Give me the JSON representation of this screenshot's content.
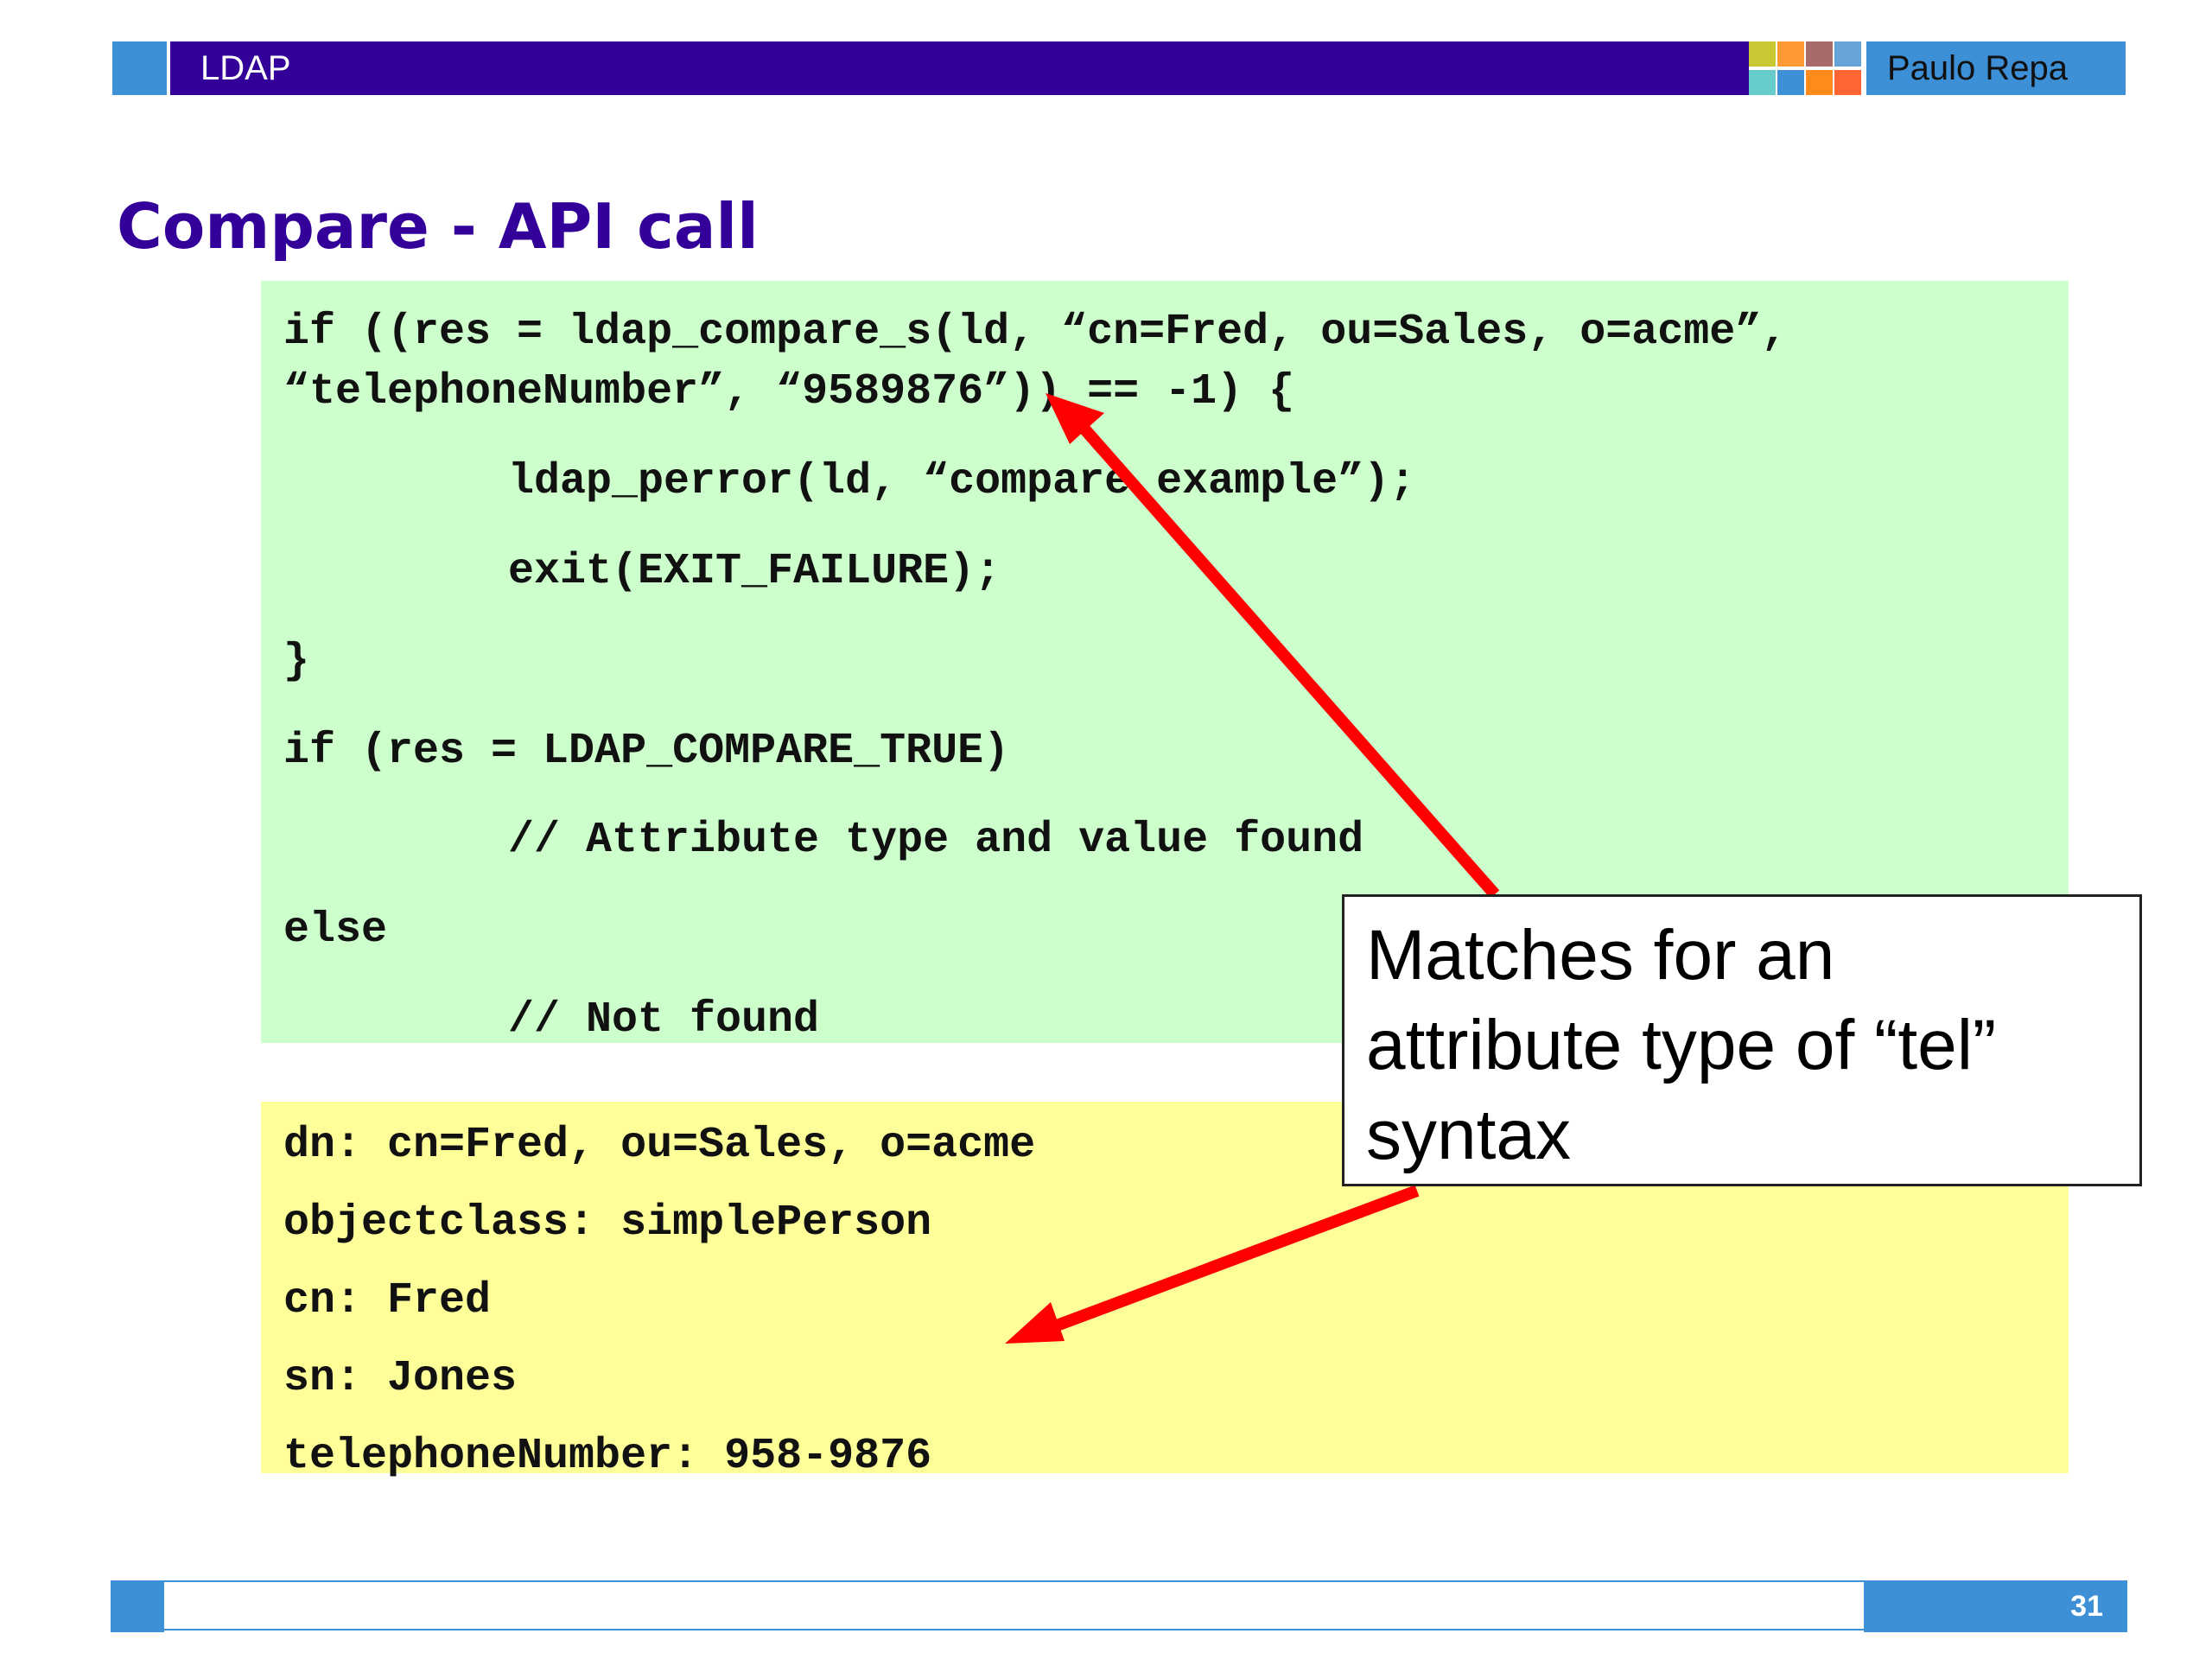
{
  "header": {
    "title": "LDAP",
    "author": "Paulo Repa",
    "accent_color": "#330099",
    "secondary_color": "#3d8fd6",
    "squares": [
      "#c8c832",
      "#ff9933",
      "#a86b6b",
      "#66a3d9",
      "#66cccc",
      "#3d8fd6",
      "#ff8c1a",
      "#ff6633"
    ]
  },
  "slide_title": "Compare - API call",
  "code": {
    "lines": [
      "if ((res = ldap_compare_s(ld, “cn=Fred, ou=Sales, o=acme”,",
      "“telephoneNumber”, “9589876”)) == -1) {",
      "ldap_perror(ld, “compare example”);",
      "exit(EXIT_FAILURE);",
      "}",
      "if (res = LDAP_COMPARE_TRUE)",
      "// Attribute type and value found",
      "else",
      "// Not found"
    ],
    "background": "#ccffcc"
  },
  "ldif": {
    "lines": [
      "dn: cn=Fred, ou=Sales, o=acme",
      "objectclass: simplePerson",
      "cn: Fred",
      "sn: Jones",
      "telephoneNumber: 958-9876"
    ],
    "background": "#ffff99"
  },
  "callout": {
    "lines": [
      "Matches for an",
      "attribute type of “tel”",
      "syntax"
    ]
  },
  "footer": {
    "page_number": "31"
  }
}
